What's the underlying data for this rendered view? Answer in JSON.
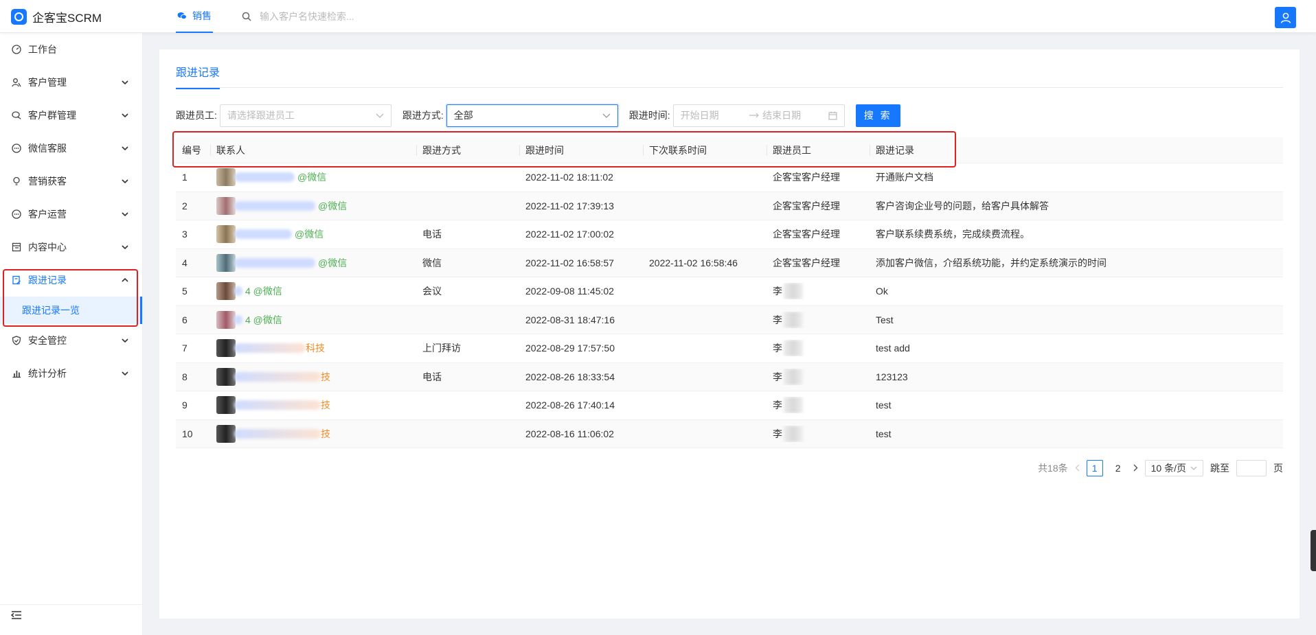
{
  "brand": {
    "name": "企客宝SCRM"
  },
  "topnav": {
    "tab_label": "销售",
    "search_placeholder": "输入客户名快速检索..."
  },
  "sidebar": {
    "items": [
      {
        "label": "工作台",
        "icon": "dashboard-icon"
      },
      {
        "label": "客户管理",
        "icon": "users-icon"
      },
      {
        "label": "客户群管理",
        "icon": "chat-group-icon"
      },
      {
        "label": "微信客服",
        "icon": "chat-dots-icon"
      },
      {
        "label": "营销获客",
        "icon": "bulb-icon"
      },
      {
        "label": "客户运营",
        "icon": "chat-dots-icon"
      },
      {
        "label": "内容中心",
        "icon": "content-icon"
      },
      {
        "label": "跟进记录",
        "icon": "record-icon",
        "open": true
      },
      {
        "label": "安全管控",
        "icon": "shield-icon"
      },
      {
        "label": "统计分析",
        "icon": "chart-icon"
      }
    ],
    "sub_items": [
      {
        "label": "跟进记录一览"
      }
    ]
  },
  "page": {
    "tab_title": "跟进记录"
  },
  "filters": {
    "staff_label": "跟进员工:",
    "staff_placeholder": "请选择跟进员工",
    "method_label": "跟进方式:",
    "method_value": "全部",
    "time_label": "跟进时间:",
    "start_placeholder": "开始日期",
    "end_placeholder": "结束日期",
    "search_label": "搜 索"
  },
  "table": {
    "columns": [
      "编号",
      "联系人",
      "跟进方式",
      "跟进时间",
      "下次联系时间",
      "跟进员工",
      "跟进记录"
    ],
    "rows": [
      {
        "id": "1",
        "contact_tag": "@微信",
        "tag_type": "wx",
        "method": "",
        "time": "2022-11-02 18:11:02",
        "next_time": "",
        "staff": "企客宝客户经理",
        "record": "开通账户文档"
      },
      {
        "id": "2",
        "contact_tag": "@微信",
        "tag_type": "wx",
        "method": "",
        "time": "2022-11-02 17:39:13",
        "next_time": "",
        "staff": "企客宝客户经理",
        "record": "客户咨询企业号的问题，给客户具体解答"
      },
      {
        "id": "3",
        "contact_tag": "@微信",
        "tag_type": "wx",
        "method": "电话",
        "time": "2022-11-02 17:00:02",
        "next_time": "",
        "staff": "企客宝客户经理",
        "record": "客户联系续费系统，完成续费流程。"
      },
      {
        "id": "4",
        "contact_tag": "@微信",
        "tag_type": "wx",
        "method": "微信",
        "time": "2022-11-02 16:58:57",
        "next_time": "2022-11-02 16:58:46",
        "staff": "企客宝客户经理",
        "record": "添加客户微信，介绍系统功能，并约定系统演示的时间"
      },
      {
        "id": "5",
        "contact_tag": "4 @微信",
        "tag_type": "wx",
        "method": "会议",
        "time": "2022-09-08 11:45:02",
        "next_time": "",
        "staff": "李",
        "record": "Ok"
      },
      {
        "id": "6",
        "contact_tag": "4 @微信",
        "tag_type": "wx",
        "method": "",
        "time": "2022-08-31 18:47:16",
        "next_time": "",
        "staff": "李",
        "record": "Test"
      },
      {
        "id": "7",
        "contact_tag": "科技",
        "tag_type": "org",
        "method": "上门拜访",
        "time": "2022-08-29 17:57:50",
        "next_time": "",
        "staff": "李",
        "record": "test add"
      },
      {
        "id": "8",
        "contact_tag": "技",
        "tag_type": "org",
        "method": "电话",
        "time": "2022-08-26 18:33:54",
        "next_time": "",
        "staff": "李",
        "record": "123123"
      },
      {
        "id": "9",
        "contact_tag": "技",
        "tag_type": "org",
        "method": "",
        "time": "2022-08-26 17:40:14",
        "next_time": "",
        "staff": "李",
        "record": "test"
      },
      {
        "id": "10",
        "contact_tag": "技",
        "tag_type": "org",
        "method": "",
        "time": "2022-08-16 11:06:02",
        "next_time": "",
        "staff": "李",
        "record": "test"
      }
    ]
  },
  "pagination": {
    "total": "共18条",
    "pages": [
      "1",
      "2"
    ],
    "current": "1",
    "page_size": "10 条/页",
    "jump_label": "跳至",
    "page_suffix": "页"
  },
  "colors": {
    "primary": "#1677ff",
    "wechat_tag": "#4caf50",
    "org_tag": "#f08a24",
    "highlight": "#e02020"
  }
}
